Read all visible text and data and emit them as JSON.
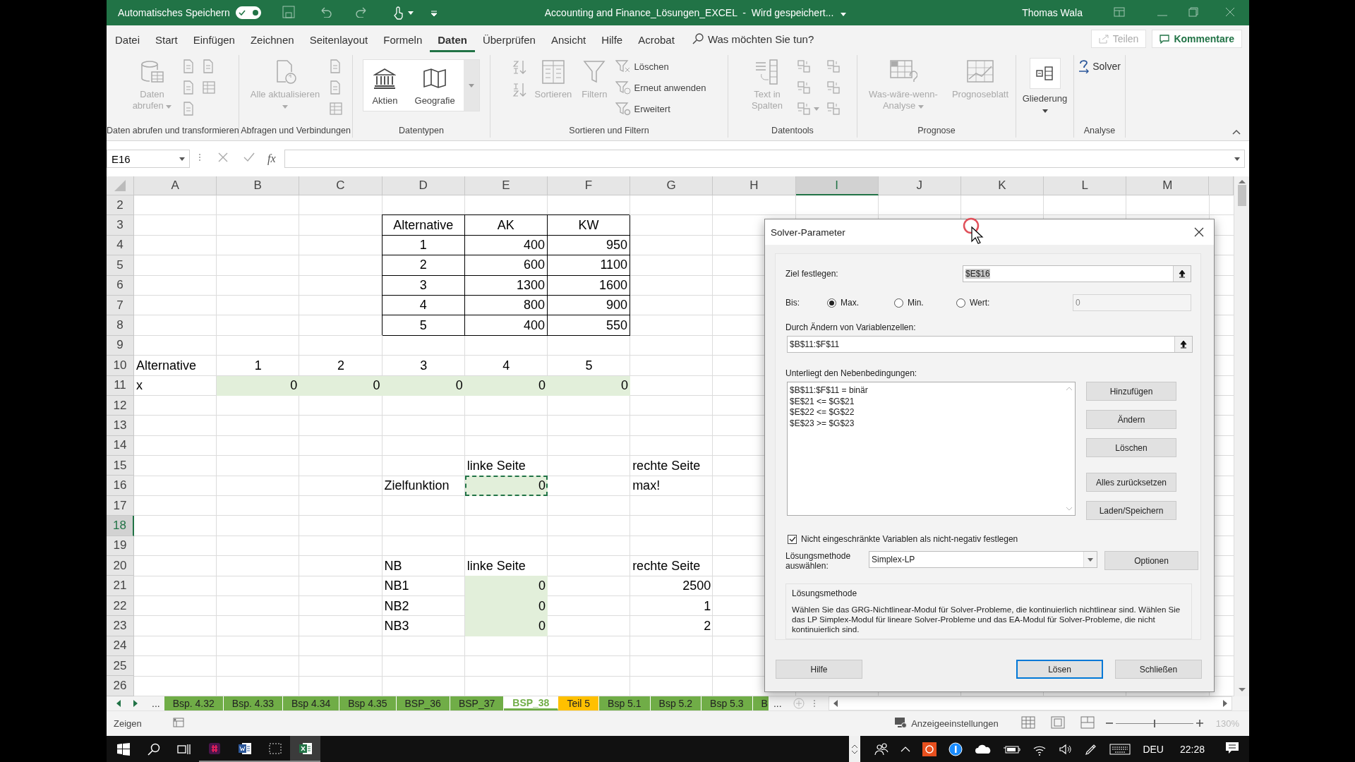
{
  "titlebar": {
    "autosave": {
      "label": "Automatisches Speichern",
      "on": true
    },
    "title": "Accounting and Finance_Lösungen_EXCEL  -  Wird gespeichert...",
    "user": "Thomas Wala"
  },
  "menu": {
    "tabs": [
      {
        "label": "Datei",
        "selected": false
      },
      {
        "label": "Start",
        "selected": false
      },
      {
        "label": "Einfügen",
        "selected": false
      },
      {
        "label": "Zeichnen",
        "selected": false
      },
      {
        "label": "Seitenlayout",
        "selected": false
      },
      {
        "label": "Formeln",
        "selected": false
      },
      {
        "label": "Daten",
        "selected": true
      },
      {
        "label": "Überprüfen",
        "selected": false
      },
      {
        "label": "Ansicht",
        "selected": false
      },
      {
        "label": "Hilfe",
        "selected": false
      },
      {
        "label": "Acrobat",
        "selected": false
      }
    ],
    "search": {
      "placeholder": "Was möchten Sie tun?"
    },
    "share": {
      "label": "Teilen",
      "disabled": true
    },
    "comments": {
      "label": "Kommentare"
    }
  },
  "ribbon": {
    "groups": [
      {
        "label": "Daten abrufen und transformieren",
        "items": [
          {
            "kind": "large",
            "label": "Daten abrufen",
            "dropdown": true,
            "disabled": true
          },
          {
            "kind": "small",
            "disabled": true
          },
          {
            "kind": "small",
            "disabled": true
          },
          {
            "kind": "small",
            "disabled": true
          },
          {
            "kind": "small",
            "disabled": true
          },
          {
            "kind": "small",
            "disabled": true
          }
        ]
      },
      {
        "label": "Abfragen und Verbindungen",
        "items": [
          {
            "kind": "large",
            "label": "Alle aktualisieren",
            "dropdown": true,
            "disabled": true
          },
          {
            "kind": "small",
            "disabled": true
          },
          {
            "kind": "small",
            "disabled": true
          },
          {
            "kind": "small",
            "disabled": true
          }
        ]
      },
      {
        "label": "Datentypen",
        "items": [
          {
            "kind": "gallery",
            "label": "Aktien",
            "disabled": false
          },
          {
            "kind": "gallery",
            "label": "Geografie",
            "disabled": false
          }
        ]
      },
      {
        "label": "Sortieren und Filtern",
        "items": [
          {
            "kind": "small",
            "disabled": true
          },
          {
            "kind": "small",
            "disabled": true
          },
          {
            "kind": "large",
            "label": "Sortieren",
            "disabled": true
          },
          {
            "kind": "large",
            "label": "Filtern",
            "disabled": true
          },
          {
            "kind": "labeled",
            "label": "Löschen",
            "disabled": true
          },
          {
            "kind": "labeled",
            "label": "Erneut anwenden",
            "disabled": true
          },
          {
            "kind": "labeled",
            "label": "Erweitert",
            "disabled": true
          }
        ]
      },
      {
        "label": "Datentools",
        "items": [
          {
            "kind": "large",
            "label": "Text in Spalten",
            "disabled": true
          },
          {
            "kind": "small",
            "disabled": true
          },
          {
            "kind": "small",
            "disabled": true
          },
          {
            "kind": "small",
            "disabled": true,
            "dropdown": true
          },
          {
            "kind": "small",
            "disabled": true
          },
          {
            "kind": "small",
            "disabled": true
          },
          {
            "kind": "small",
            "disabled": true
          }
        ]
      },
      {
        "label": "Prognose",
        "items": [
          {
            "kind": "large",
            "label": "Was-wäre-wenn-Analyse",
            "dropdown": true,
            "disabled": true
          },
          {
            "kind": "large",
            "label": "Prognoseblatt",
            "disabled": true
          }
        ]
      },
      {
        "items": [
          {
            "kind": "large",
            "label": "Gliederung",
            "dropdown": true,
            "disabled": false
          }
        ]
      },
      {
        "label": "Analyse",
        "items": [
          {
            "kind": "labeled",
            "label": "Solver",
            "disabled": false
          }
        ]
      }
    ]
  },
  "formula_bar": {
    "name_box": "E16",
    "function_label": "fx"
  },
  "sheet": {
    "columns": [
      {
        "label": "A",
        "selected": false
      },
      {
        "label": "B",
        "selected": false
      },
      {
        "label": "C",
        "selected": false
      },
      {
        "label": "D",
        "selected": false
      },
      {
        "label": "E",
        "selected": false
      },
      {
        "label": "F",
        "selected": false
      },
      {
        "label": "G",
        "selected": false
      },
      {
        "label": "H",
        "selected": false
      },
      {
        "label": "I",
        "selected": true
      },
      {
        "label": "J",
        "selected": false
      },
      {
        "label": "K",
        "selected": false
      },
      {
        "label": "L",
        "selected": false
      },
      {
        "label": "M",
        "selected": false
      }
    ],
    "rows": [
      {
        "number": "2",
        "selected": false
      },
      {
        "number": "3",
        "selected": false,
        "cells": [
          {},
          {},
          {},
          {
            "text": "Alternative",
            "centered": true,
            "bordered": true
          },
          {
            "text": "AK",
            "centered": true,
            "bordered": true
          },
          {
            "text": "KW",
            "centered": true,
            "bordered": true
          }
        ]
      },
      {
        "number": "4",
        "selected": false,
        "cells": [
          {},
          {},
          {},
          {
            "text": "1",
            "centered": true,
            "bordered": true
          },
          {
            "text": "400",
            "numeric": true,
            "bordered": true
          },
          {
            "text": "950",
            "numeric": true,
            "bordered": true
          }
        ]
      },
      {
        "number": "5",
        "selected": false,
        "cells": [
          {},
          {},
          {},
          {
            "text": "2",
            "centered": true,
            "bordered": true
          },
          {
            "text": "600",
            "numeric": true,
            "bordered": true
          },
          {
            "text": "1100",
            "numeric": true,
            "bordered": true
          }
        ]
      },
      {
        "number": "6",
        "selected": false,
        "cells": [
          {},
          {},
          {},
          {
            "text": "3",
            "centered": true,
            "bordered": true
          },
          {
            "text": "1300",
            "numeric": true,
            "bordered": true
          },
          {
            "text": "1600",
            "numeric": true,
            "bordered": true
          }
        ]
      },
      {
        "number": "7",
        "selected": false,
        "cells": [
          {},
          {},
          {},
          {
            "text": "4",
            "centered": true,
            "bordered": true
          },
          {
            "text": "800",
            "numeric": true,
            "bordered": true
          },
          {
            "text": "900",
            "numeric": true,
            "bordered": true
          }
        ]
      },
      {
        "number": "8",
        "selected": false,
        "cells": [
          {},
          {},
          {},
          {
            "text": "5",
            "centered": true,
            "bordered": true
          },
          {
            "text": "400",
            "numeric": true,
            "bordered": true
          },
          {
            "text": "550",
            "numeric": true,
            "bordered": true
          }
        ]
      },
      {
        "number": "9",
        "selected": false
      },
      {
        "number": "10",
        "selected": false,
        "cells": [
          {
            "text": "Alternative"
          },
          {
            "text": "1",
            "centered": true
          },
          {
            "text": "2",
            "centered": true
          },
          {
            "text": "3",
            "centered": true
          },
          {
            "text": "4",
            "centered": true
          },
          {
            "text": "5",
            "centered": true
          }
        ]
      },
      {
        "number": "11",
        "selected": false,
        "cells": [
          {
            "text": "x"
          },
          {
            "text": "0",
            "numeric": true,
            "shaded": true
          },
          {
            "text": "0",
            "numeric": true,
            "shaded": true
          },
          {
            "text": "0",
            "numeric": true,
            "shaded": true
          },
          {
            "text": "0",
            "numeric": true,
            "shaded": true
          },
          {
            "text": "0",
            "numeric": true,
            "shaded": true
          }
        ]
      },
      {
        "number": "12",
        "selected": false
      },
      {
        "number": "13",
        "selected": false
      },
      {
        "number": "14",
        "selected": false
      },
      {
        "number": "15",
        "selected": false,
        "cells": [
          {},
          {},
          {},
          {},
          {
            "text": "linke Seite"
          },
          {},
          {
            "text": "rechte Seite"
          }
        ]
      },
      {
        "number": "16",
        "selected": false,
        "cells": [
          {},
          {},
          {},
          {
            "text": "Zielfunktion"
          },
          {
            "text": "0",
            "numeric": true,
            "shaded": true,
            "marquee": true
          },
          {},
          {
            "text": "max!"
          }
        ]
      },
      {
        "number": "17",
        "selected": false
      },
      {
        "number": "18",
        "selected": true
      },
      {
        "number": "19",
        "selected": false
      },
      {
        "number": "20",
        "selected": false,
        "cells": [
          {},
          {},
          {},
          {
            "text": "NB"
          },
          {
            "text": "linke Seite"
          },
          {},
          {
            "text": "rechte Seite"
          }
        ]
      },
      {
        "number": "21",
        "selected": false,
        "cells": [
          {},
          {},
          {},
          {
            "text": "NB1"
          },
          {
            "text": "0",
            "numeric": true,
            "shaded": true
          },
          {},
          {
            "text": "2500",
            "numeric": true
          }
        ]
      },
      {
        "number": "22",
        "selected": false,
        "cells": [
          {},
          {},
          {},
          {
            "text": "NB2"
          },
          {
            "text": "0",
            "numeric": true,
            "shaded": true
          },
          {},
          {
            "text": "1",
            "numeric": true
          }
        ]
      },
      {
        "number": "23",
        "selected": false,
        "cells": [
          {},
          {},
          {},
          {
            "text": "NB3"
          },
          {
            "text": "0",
            "numeric": true,
            "shaded": true
          },
          {},
          {
            "text": "2",
            "numeric": true
          }
        ]
      },
      {
        "number": "24",
        "selected": false
      },
      {
        "number": "25",
        "selected": false
      },
      {
        "number": "26",
        "selected": false
      }
    ]
  },
  "sheet_tabs": {
    "overflow_left": "...",
    "overflow_right": "...",
    "tabs": [
      {
        "label": "Bsp. 4.32",
        "color": "#70ad47",
        "selected": false
      },
      {
        "label": "Bsp. 4.33",
        "color": "#70ad47",
        "selected": false
      },
      {
        "label": "Bsp 4.34",
        "color": "#70ad47",
        "selected": false
      },
      {
        "label": "Bsp 4.35",
        "color": "#70ad47",
        "selected": false
      },
      {
        "label": "BSP_36",
        "color": "#70ad47",
        "selected": false
      },
      {
        "label": "BSP_37",
        "color": "#70ad47",
        "selected": false
      },
      {
        "label": "BSP_38",
        "color": "#70ad47",
        "selected": true
      },
      {
        "label": "Teil 5",
        "color": "#ffc000",
        "selected": false
      },
      {
        "label": "Bsp 5.1",
        "color": "#70ad47",
        "selected": false
      },
      {
        "label": "Bsp 5.2",
        "color": "#70ad47",
        "selected": false
      },
      {
        "label": "Bsp 5.3",
        "color": "#70ad47",
        "selected": false
      },
      {
        "label": "B",
        "color": "#70ad47",
        "selected": false
      }
    ]
  },
  "status": {
    "mode": "Zeigen",
    "display_settings": "Anzeigeeinstellungen",
    "zoom": {
      "level": 0.5,
      "reading": "130%"
    }
  },
  "dialog": {
    "title": "Solver-Parameter",
    "objective": {
      "label": "Ziel festlegen:",
      "value": "$E$16",
      "highlighted": true
    },
    "to": {
      "label": "Bis:",
      "options": [
        {
          "label": "Max.",
          "selected": true
        },
        {
          "label": "Min.",
          "selected": false
        },
        {
          "label": "Wert:",
          "selected": false
        }
      ],
      "value_field": {
        "value": "0",
        "disabled": true
      }
    },
    "variables": {
      "label": "Durch Ändern von Variablenzellen:",
      "value": "$B$11:$F$11"
    },
    "constraints": {
      "label": "Unterliegt den Nebenbedingungen:",
      "items": [
        "$B$11:$F$11 = binär",
        "$E$21 <= $G$21",
        "$E$22 <= $G$22",
        "$E$23 >= $G$23"
      ]
    },
    "side_buttons": [
      "Hinzufügen",
      "Ändern",
      "Löschen",
      "Alles zurücksetzen",
      "Laden/Speichern"
    ],
    "nonnegative": {
      "label": "Nicht eingeschränkte Variablen als nicht-negativ festlegen",
      "checked": true
    },
    "method": {
      "label": "Lösungsmethode auswählen:",
      "value": "Simplex-LP",
      "button": "Optionen"
    },
    "method_info": {
      "title": "Lösungsmethode",
      "text": "Wählen Sie das GRG-Nichtlinear-Modul für Solver-Probleme, die kontinuierlich nichtlinear sind. Wählen Sie das LP Simplex-Modul für lineare Solver-Probleme und das EA-Modul für Solver-Probleme, die nicht kontinuierlich sind."
    },
    "buttons": [
      {
        "label": "Hilfe",
        "default": false
      },
      {
        "label": "Lösen",
        "default": true
      },
      {
        "label": "Schließen",
        "default": false
      }
    ]
  },
  "taskbar": {
    "apps": [
      {
        "kind": "chat",
        "active": false
      },
      {
        "kind": "word",
        "active": false
      },
      {
        "kind": "snip",
        "active": false
      },
      {
        "kind": "excel",
        "active": true
      }
    ],
    "language": "DEU",
    "time": "22:28"
  }
}
